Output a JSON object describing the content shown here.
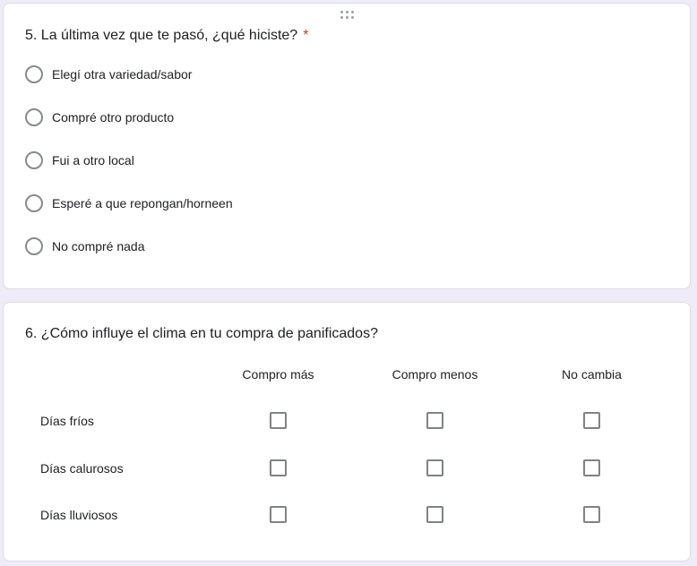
{
  "question5": {
    "number_title": "5. La última vez que te pasó, ¿qué hiciste?",
    "required_mark": "*",
    "options": [
      "Elegí otra variedad/sabor",
      "Compré otro producto",
      "Fui a otro local",
      "Esperé a que repongan/horneen",
      "No compré nada"
    ]
  },
  "question6": {
    "number_title": "6. ¿Cómo influye el clima en tu compra de panificados?",
    "columns": [
      "Compro más",
      "Compro menos",
      "No cambia"
    ],
    "rows": [
      "Días fríos",
      "Días calurosos",
      "Días lluviosos"
    ]
  },
  "colors": {
    "page_background": "#f0ebf8",
    "card_background": "#ffffff",
    "required_asterisk": "#d93025",
    "control_border": "#5f6368"
  },
  "icons": {
    "drag_handle": "drag-handle-icon",
    "radio": "radio-unchecked-icon",
    "checkbox": "checkbox-unchecked-icon"
  }
}
